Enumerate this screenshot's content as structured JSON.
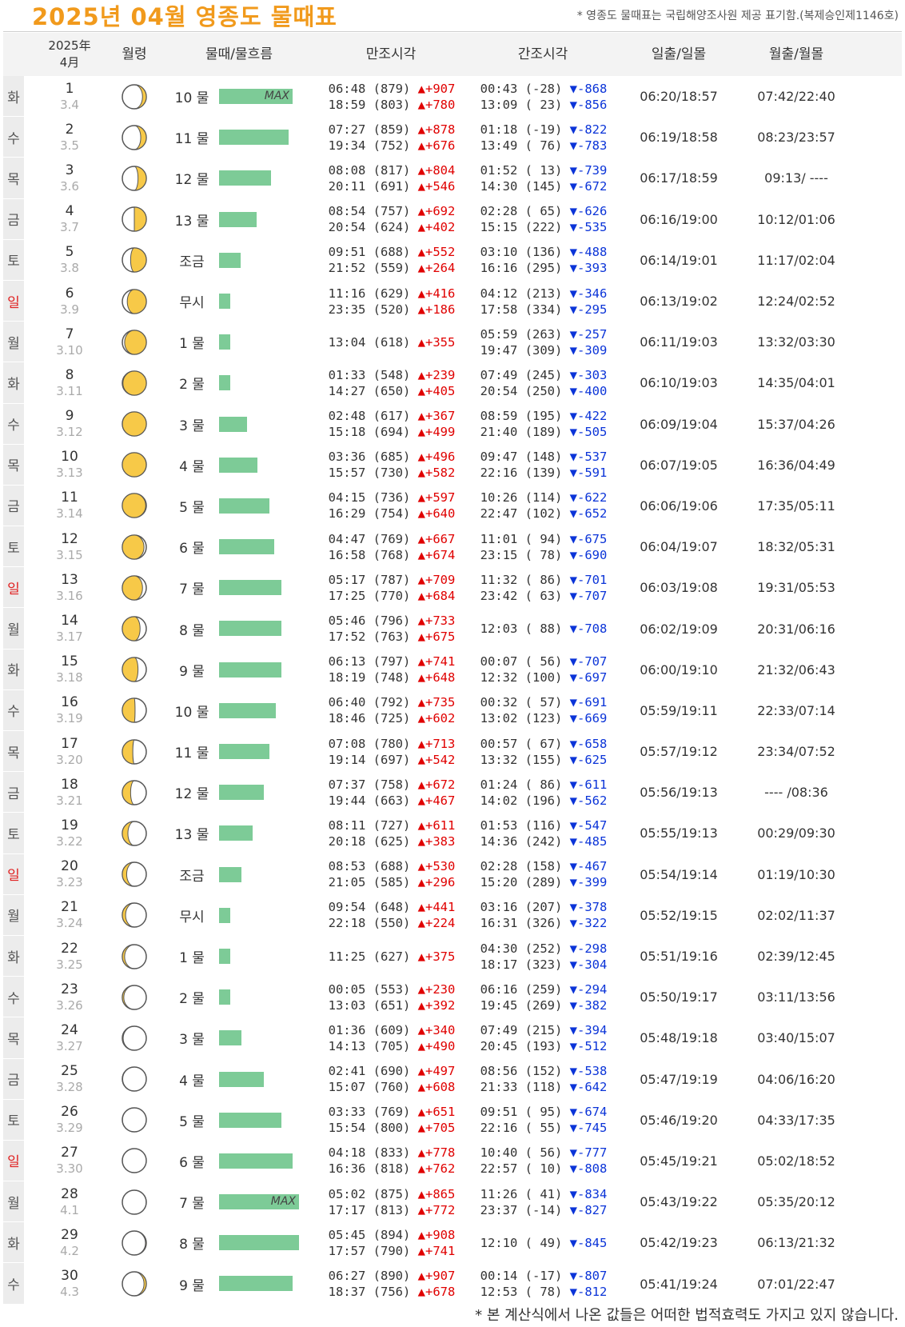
{
  "page": {
    "title": "2025년 04월 영종도 물때표",
    "source_note": "* 영종도 물때표는 국립해양조사원 제공 표기함.(복제승인제1146호)",
    "footnote": "* 본 계산식에서 나온 값들은 어떠한 법적효력도 가지고 있지 않습니다."
  },
  "header": {
    "year": "2025年",
    "month": "4月",
    "moon_age": "월령",
    "tide_flow": "물때/물흐름",
    "high_tide": "만조시각",
    "low_tide": "간조시각",
    "sunrise_sunset": "일출/일몰",
    "moonrise_moonset": "월출/월몰"
  },
  "colors": {
    "title": "#f19a1c",
    "bar": "#7dcb97",
    "rise": "#e00000",
    "fall": "#0b34d8",
    "sunday": "#e02020",
    "moon": "#f7c948"
  },
  "max_label": "MAX",
  "rows": [
    {
      "dow": "화",
      "day": "1",
      "lunar": "3.4",
      "phase": 0.13,
      "mul": "10 물",
      "bar": 0.92,
      "max": true,
      "hi": [
        [
          "06:48",
          "(879)",
          "+907"
        ],
        [
          "18:59",
          "(803)",
          "+780"
        ]
      ],
      "lo": [
        [
          "00:43",
          "(-28)",
          "-868"
        ],
        [
          "13:09",
          "( 23)",
          "-856"
        ]
      ],
      "sun": "06:20/18:57",
      "moon": "07:42/22:40"
    },
    {
      "dow": "수",
      "day": "2",
      "lunar": "3.5",
      "phase": 0.16,
      "mul": "11 물",
      "bar": 0.87,
      "max": false,
      "hi": [
        [
          "07:27",
          "(859)",
          "+878"
        ],
        [
          "19:34",
          "(752)",
          "+676"
        ]
      ],
      "lo": [
        [
          "01:18",
          "(-19)",
          "-822"
        ],
        [
          "13:49",
          "( 76)",
          "-783"
        ]
      ],
      "sun": "06:19/18:58",
      "moon": "08:23/23:57"
    },
    {
      "dow": "목",
      "day": "3",
      "lunar": "3.6",
      "phase": 0.2,
      "mul": "12 물",
      "bar": 0.65,
      "max": false,
      "hi": [
        [
          "08:08",
          "(817)",
          "+804"
        ],
        [
          "20:11",
          "(691)",
          "+546"
        ]
      ],
      "lo": [
        [
          "01:52",
          "( 13)",
          "-739"
        ],
        [
          "14:30",
          "(145)",
          "-672"
        ]
      ],
      "sun": "06:17/18:59",
      "moon": "09:13/ ----"
    },
    {
      "dow": "금",
      "day": "4",
      "lunar": "3.7",
      "phase": 0.25,
      "mul": "13 물",
      "bar": 0.47,
      "max": false,
      "hi": [
        [
          "08:54",
          "(757)",
          "+692"
        ],
        [
          "20:54",
          "(624)",
          "+402"
        ]
      ],
      "lo": [
        [
          "02:28",
          "( 65)",
          "-626"
        ],
        [
          "15:15",
          "(222)",
          "-535"
        ]
      ],
      "sun": "06:16/19:00",
      "moon": "10:12/01:06"
    },
    {
      "dow": "토",
      "day": "5",
      "lunar": "3.8",
      "phase": 0.3,
      "mul": "조금",
      "bar": 0.27,
      "max": false,
      "hi": [
        [
          "09:51",
          "(688)",
          "+552"
        ],
        [
          "21:52",
          "(559)",
          "+264"
        ]
      ],
      "lo": [
        [
          "03:10",
          "(136)",
          "-488"
        ],
        [
          "16:16",
          "(295)",
          "-393"
        ]
      ],
      "sun": "06:14/19:01",
      "moon": "11:17/02:04"
    },
    {
      "dow": "일",
      "day": "6",
      "lunar": "3.9",
      "phase": 0.35,
      "mul": "무시",
      "bar": 0.14,
      "max": false,
      "sun_day": true,
      "hi": [
        [
          "11:16",
          "(629)",
          "+416"
        ],
        [
          "23:35",
          "(520)",
          "+186"
        ]
      ],
      "lo": [
        [
          "04:12",
          "(213)",
          "-346"
        ],
        [
          "17:58",
          "(334)",
          "-295"
        ]
      ],
      "sun": "06:13/19:02",
      "moon": "12:24/02:52"
    },
    {
      "dow": "월",
      "day": "7",
      "lunar": "3.10",
      "phase": 0.4,
      "mul": "1 물",
      "bar": 0.14,
      "max": false,
      "hi": [
        [
          "13:04",
          "(618)",
          "+355"
        ]
      ],
      "lo": [
        [
          "05:59",
          "(263)",
          "-257"
        ],
        [
          "19:47",
          "(309)",
          "-309"
        ]
      ],
      "sun": "06:11/19:03",
      "moon": "13:32/03:30"
    },
    {
      "dow": "화",
      "day": "8",
      "lunar": "3.11",
      "phase": 0.45,
      "mul": "2 물",
      "bar": 0.14,
      "max": false,
      "hi": [
        [
          "01:33",
          "(548)",
          "+239"
        ],
        [
          "14:27",
          "(650)",
          "+405"
        ]
      ],
      "lo": [
        [
          "07:49",
          "(245)",
          "-303"
        ],
        [
          "20:54",
          "(250)",
          "-400"
        ]
      ],
      "sun": "06:10/19:03",
      "moon": "14:35/04:01"
    },
    {
      "dow": "수",
      "day": "9",
      "lunar": "3.12",
      "phase": 0.48,
      "mul": "3 물",
      "bar": 0.35,
      "max": false,
      "hi": [
        [
          "02:48",
          "(617)",
          "+367"
        ],
        [
          "15:18",
          "(694)",
          "+499"
        ]
      ],
      "lo": [
        [
          "08:59",
          "(195)",
          "-422"
        ],
        [
          "21:40",
          "(189)",
          "-505"
        ]
      ],
      "sun": "06:09/19:04",
      "moon": "15:37/04:26"
    },
    {
      "dow": "목",
      "day": "10",
      "lunar": "3.13",
      "phase": 0.52,
      "mul": "4 물",
      "bar": 0.48,
      "max": false,
      "hi": [
        [
          "03:36",
          "(685)",
          "+496"
        ],
        [
          "15:57",
          "(730)",
          "+582"
        ]
      ],
      "lo": [
        [
          "09:47",
          "(148)",
          "-537"
        ],
        [
          "22:16",
          "(139)",
          "-591"
        ]
      ],
      "sun": "06:07/19:05",
      "moon": "16:36/04:49"
    },
    {
      "dow": "금",
      "day": "11",
      "lunar": "3.14",
      "phase": 0.55,
      "mul": "5 물",
      "bar": 0.63,
      "max": false,
      "hi": [
        [
          "04:15",
          "(736)",
          "+597"
        ],
        [
          "16:29",
          "(754)",
          "+640"
        ]
      ],
      "lo": [
        [
          "10:26",
          "(114)",
          "-622"
        ],
        [
          "22:47",
          "(102)",
          "-652"
        ]
      ],
      "sun": "06:06/19:06",
      "moon": "17:35/05:11"
    },
    {
      "dow": "토",
      "day": "12",
      "lunar": "3.15",
      "phase": 0.6,
      "mul": "6 물",
      "bar": 0.69,
      "max": false,
      "hi": [
        [
          "04:47",
          "(769)",
          "+667"
        ],
        [
          "16:58",
          "(768)",
          "+674"
        ]
      ],
      "lo": [
        [
          "11:01",
          "( 94)",
          "-675"
        ],
        [
          "23:15",
          "( 78)",
          "-690"
        ]
      ],
      "sun": "06:04/19:07",
      "moon": "18:32/05:31"
    },
    {
      "dow": "일",
      "day": "13",
      "lunar": "3.16",
      "phase": 0.63,
      "mul": "7 물",
      "bar": 0.78,
      "max": false,
      "sun_day": true,
      "hi": [
        [
          "05:17",
          "(787)",
          "+709"
        ],
        [
          "17:25",
          "(770)",
          "+684"
        ]
      ],
      "lo": [
        [
          "11:32",
          "( 86)",
          "-701"
        ],
        [
          "23:42",
          "( 63)",
          "-707"
        ]
      ],
      "sun": "06:03/19:08",
      "moon": "19:31/05:53"
    },
    {
      "dow": "월",
      "day": "14",
      "lunar": "3.17",
      "phase": 0.67,
      "mul": "8 물",
      "bar": 0.78,
      "max": false,
      "hi": [
        [
          "05:46",
          "(796)",
          "+733"
        ],
        [
          "17:52",
          "(763)",
          "+675"
        ]
      ],
      "lo": [
        [
          "12:03",
          "( 88)",
          "-708"
        ]
      ],
      "sun": "06:02/19:09",
      "moon": "20:31/06:16"
    },
    {
      "dow": "화",
      "day": "15",
      "lunar": "3.18",
      "phase": 0.7,
      "mul": "9 물",
      "bar": 0.78,
      "max": false,
      "hi": [
        [
          "06:13",
          "(797)",
          "+741"
        ],
        [
          "18:19",
          "(748)",
          "+648"
        ]
      ],
      "lo": [
        [
          "00:07",
          "( 56)",
          "-707"
        ],
        [
          "12:32",
          "(100)",
          "-697"
        ]
      ],
      "sun": "06:00/19:10",
      "moon": "21:32/06:43"
    },
    {
      "dow": "수",
      "day": "16",
      "lunar": "3.19",
      "phase": 0.74,
      "mul": "10 물",
      "bar": 0.71,
      "max": false,
      "hi": [
        [
          "06:40",
          "(792)",
          "+735"
        ],
        [
          "18:46",
          "(725)",
          "+602"
        ]
      ],
      "lo": [
        [
          "00:32",
          "( 57)",
          "-691"
        ],
        [
          "13:02",
          "(123)",
          "-669"
        ]
      ],
      "sun": "05:59/19:11",
      "moon": "22:33/07:14"
    },
    {
      "dow": "목",
      "day": "17",
      "lunar": "3.20",
      "phase": 0.77,
      "mul": "11 물",
      "bar": 0.63,
      "max": false,
      "hi": [
        [
          "07:08",
          "(780)",
          "+713"
        ],
        [
          "19:14",
          "(697)",
          "+542"
        ]
      ],
      "lo": [
        [
          "00:57",
          "( 67)",
          "-658"
        ],
        [
          "13:32",
          "(155)",
          "-625"
        ]
      ],
      "sun": "05:57/19:12",
      "moon": "23:34/07:52"
    },
    {
      "dow": "금",
      "day": "18",
      "lunar": "3.21",
      "phase": 0.8,
      "mul": "12 물",
      "bar": 0.56,
      "max": false,
      "hi": [
        [
          "07:37",
          "(758)",
          "+672"
        ],
        [
          "19:44",
          "(663)",
          "+467"
        ]
      ],
      "lo": [
        [
          "01:24",
          "( 86)",
          "-611"
        ],
        [
          "14:02",
          "(196)",
          "-562"
        ]
      ],
      "sun": "05:56/19:13",
      "moon": "---- /08:36"
    },
    {
      "dow": "토",
      "day": "19",
      "lunar": "3.22",
      "phase": 0.84,
      "mul": "13 물",
      "bar": 0.42,
      "max": false,
      "hi": [
        [
          "08:11",
          "(727)",
          "+611"
        ],
        [
          "20:18",
          "(625)",
          "+383"
        ]
      ],
      "lo": [
        [
          "01:53",
          "(116)",
          "-547"
        ],
        [
          "14:36",
          "(242)",
          "-485"
        ]
      ],
      "sun": "05:55/19:13",
      "moon": "00:29/09:30"
    },
    {
      "dow": "일",
      "day": "20",
      "lunar": "3.23",
      "phase": 0.86,
      "mul": "조금",
      "bar": 0.28,
      "max": false,
      "sun_day": true,
      "hi": [
        [
          "08:53",
          "(688)",
          "+530"
        ],
        [
          "21:05",
          "(585)",
          "+296"
        ]
      ],
      "lo": [
        [
          "02:28",
          "(158)",
          "-467"
        ],
        [
          "15:20",
          "(289)",
          "-399"
        ]
      ],
      "sun": "05:54/19:14",
      "moon": "01:19/10:30"
    },
    {
      "dow": "월",
      "day": "21",
      "lunar": "3.24",
      "phase": 0.88,
      "mul": "무시",
      "bar": 0.14,
      "max": false,
      "hi": [
        [
          "09:54",
          "(648)",
          "+441"
        ],
        [
          "22:18",
          "(550)",
          "+224"
        ]
      ],
      "lo": [
        [
          "03:16",
          "(207)",
          "-378"
        ],
        [
          "16:31",
          "(326)",
          "-322"
        ]
      ],
      "sun": "05:52/19:15",
      "moon": "02:02/11:37"
    },
    {
      "dow": "화",
      "day": "22",
      "lunar": "3.25",
      "phase": 0.9,
      "mul": "1 물",
      "bar": 0.14,
      "max": false,
      "hi": [
        [
          "11:25",
          "(627)",
          "+375"
        ]
      ],
      "lo": [
        [
          "04:30",
          "(252)",
          "-298"
        ],
        [
          "18:17",
          "(323)",
          "-304"
        ]
      ],
      "sun": "05:51/19:16",
      "moon": "02:39/12:45"
    },
    {
      "dow": "수",
      "day": "23",
      "lunar": "3.26",
      "phase": 0.92,
      "mul": "2 물",
      "bar": 0.14,
      "max": false,
      "hi": [
        [
          "00:05",
          "(553)",
          "+230"
        ],
        [
          "13:03",
          "(651)",
          "+392"
        ]
      ],
      "lo": [
        [
          "06:16",
          "(259)",
          "-294"
        ],
        [
          "19:45",
          "(269)",
          "-382"
        ]
      ],
      "sun": "05:50/19:17",
      "moon": "03:11/13:56"
    },
    {
      "dow": "목",
      "day": "24",
      "lunar": "3.27",
      "phase": 0.94,
      "mul": "3 물",
      "bar": 0.28,
      "max": false,
      "hi": [
        [
          "01:36",
          "(609)",
          "+340"
        ],
        [
          "14:13",
          "(705)",
          "+490"
        ]
      ],
      "lo": [
        [
          "07:49",
          "(215)",
          "-394"
        ],
        [
          "20:45",
          "(193)",
          "-512"
        ]
      ],
      "sun": "05:48/19:18",
      "moon": "03:40/15:07"
    },
    {
      "dow": "금",
      "day": "25",
      "lunar": "3.28",
      "phase": 0.96,
      "mul": "4 물",
      "bar": 0.56,
      "max": false,
      "hi": [
        [
          "02:41",
          "(690)",
          "+497"
        ],
        [
          "15:07",
          "(760)",
          "+608"
        ]
      ],
      "lo": [
        [
          "08:56",
          "(152)",
          "-538"
        ],
        [
          "21:33",
          "(118)",
          "-642"
        ]
      ],
      "sun": "05:47/19:19",
      "moon": "04:06/16:20"
    },
    {
      "dow": "토",
      "day": "26",
      "lunar": "3.29",
      "phase": 0.98,
      "mul": "5 물",
      "bar": 0.78,
      "max": false,
      "hi": [
        [
          "03:33",
          "(769)",
          "+651"
        ],
        [
          "15:54",
          "(800)",
          "+705"
        ]
      ],
      "lo": [
        [
          "09:51",
          "( 95)",
          "-674"
        ],
        [
          "22:16",
          "( 55)",
          "-745"
        ]
      ],
      "sun": "05:46/19:20",
      "moon": "04:33/17:35"
    },
    {
      "dow": "일",
      "day": "27",
      "lunar": "3.30",
      "phase": 1.0,
      "mul": "6 물",
      "bar": 0.92,
      "max": false,
      "sun_day": true,
      "hi": [
        [
          "04:18",
          "(833)",
          "+778"
        ],
        [
          "16:36",
          "(818)",
          "+762"
        ]
      ],
      "lo": [
        [
          "10:40",
          "( 56)",
          "-777"
        ],
        [
          "22:57",
          "( 10)",
          "-808"
        ]
      ],
      "sun": "05:45/19:21",
      "moon": "05:02/18:52"
    },
    {
      "dow": "월",
      "day": "28",
      "lunar": "4.1",
      "phase": 0.02,
      "mul": "7 물",
      "bar": 1.0,
      "max": true,
      "hi": [
        [
          "05:02",
          "(875)",
          "+865"
        ],
        [
          "17:17",
          "(813)",
          "+772"
        ]
      ],
      "lo": [
        [
          "11:26",
          "( 41)",
          "-834"
        ],
        [
          "23:37",
          "(-14)",
          "-827"
        ]
      ],
      "sun": "05:43/19:22",
      "moon": "05:35/20:12"
    },
    {
      "dow": "화",
      "day": "29",
      "lunar": "4.2",
      "phase": 0.06,
      "mul": "8 물",
      "bar": 1.0,
      "max": false,
      "hi": [
        [
          "05:45",
          "(894)",
          "+908"
        ],
        [
          "17:57",
          "(790)",
          "+741"
        ]
      ],
      "lo": [
        [
          "12:10",
          "( 49)",
          "-845"
        ]
      ],
      "sun": "05:42/19:23",
      "moon": "06:13/21:32"
    },
    {
      "dow": "수",
      "day": "30",
      "lunar": "4.3",
      "phase": 0.1,
      "mul": "9 물",
      "bar": 0.92,
      "max": false,
      "hi": [
        [
          "06:27",
          "(890)",
          "+907"
        ],
        [
          "18:37",
          "(756)",
          "+678"
        ]
      ],
      "lo": [
        [
          "00:14",
          "(-17)",
          "-807"
        ],
        [
          "12:53",
          "( 78)",
          "-812"
        ]
      ],
      "sun": "05:41/19:24",
      "moon": "07:01/22:47"
    }
  ]
}
